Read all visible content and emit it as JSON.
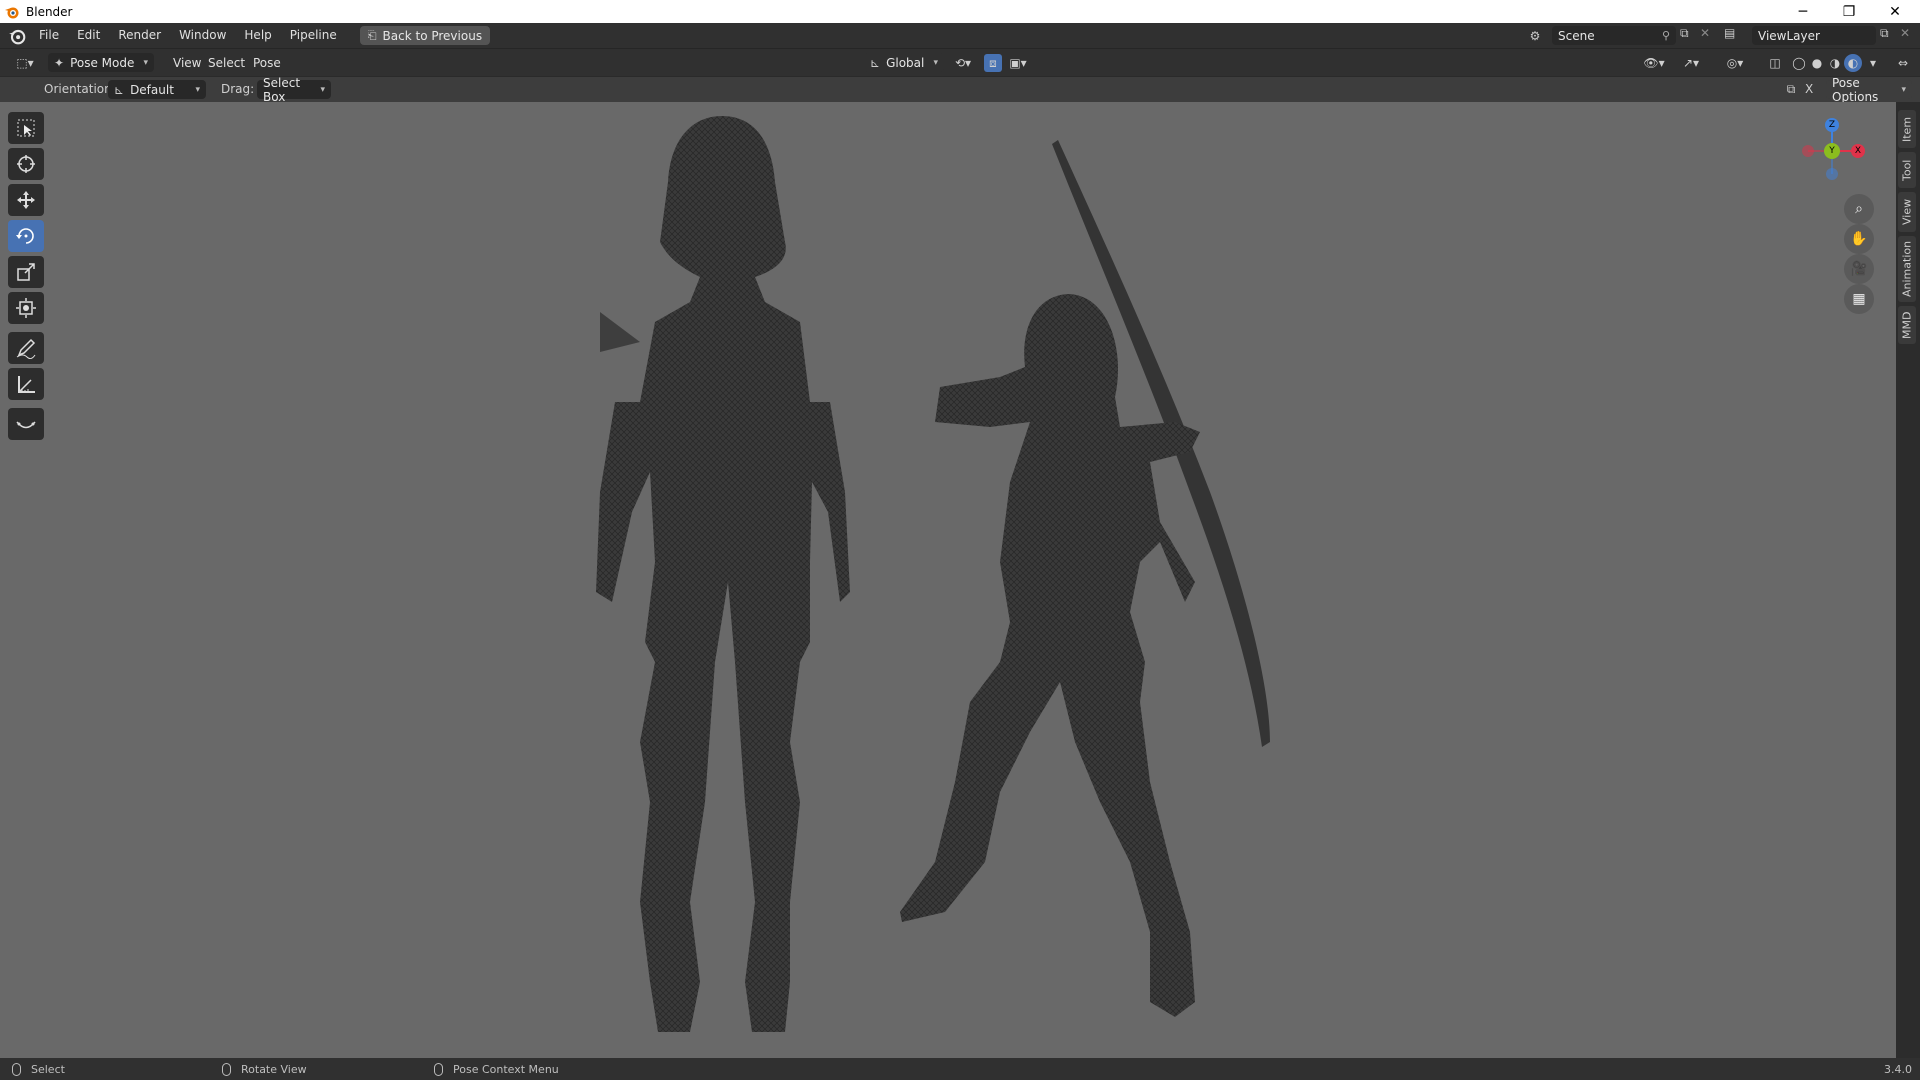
{
  "window": {
    "title": "Blender",
    "minimize": "─",
    "maximize": "❐",
    "close": "✕"
  },
  "menubar": {
    "items": [
      "File",
      "Edit",
      "Render",
      "Window",
      "Help",
      "Pipeline"
    ],
    "back_button": "Back to Previous",
    "scene_label": "Scene",
    "viewlayer_label": "ViewLayer"
  },
  "header": {
    "mode": "Pose Mode",
    "menus": [
      "View",
      "Select",
      "Pose"
    ],
    "transform_orientation": "Global"
  },
  "tool_header": {
    "orientation_label": "Orientation:",
    "orientation_value": "Default",
    "drag_label": "Drag:",
    "drag_value": "Select Box",
    "pose_options": "Pose Options",
    "x_label": "X"
  },
  "gizmo": {
    "z": "Z",
    "y": "Y",
    "x": "X"
  },
  "sidebar_tabs": [
    "Item",
    "Tool",
    "View",
    "Animation",
    "MMD"
  ],
  "toolbar": {
    "tools": [
      "select-box",
      "cursor",
      "move",
      "rotate",
      "scale",
      "transform",
      "annotate",
      "measure",
      "relax-pose"
    ],
    "active_tool": "rotate"
  },
  "statusbar": {
    "left": "Select",
    "middle": "Rotate View",
    "right": "Pose Context Menu",
    "version": "3.4.0"
  },
  "colors": {
    "accent": "#4772b3",
    "viewport_bg": "#696969",
    "axis_x": "#e0334a",
    "axis_y": "#8bbd1e",
    "axis_z": "#3f82de"
  }
}
